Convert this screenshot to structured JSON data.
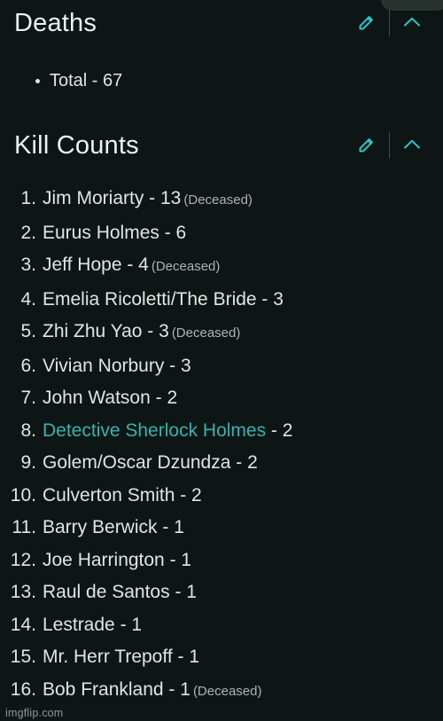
{
  "accent_color": "#28c8c8",
  "link_color": "#35b3b3",
  "background_color": "#0d1614",
  "text_color": "#dfe6e4",
  "sections": {
    "deaths": {
      "title": "Deaths",
      "edit_icon": "pencil-icon",
      "collapse_icon": "chevron-up-icon",
      "bullets": [
        {
          "text": "Total - 67"
        }
      ]
    },
    "kill_counts": {
      "title": "Kill Counts",
      "edit_icon": "pencil-icon",
      "collapse_icon": "chevron-up-icon",
      "items": [
        {
          "num": "1.",
          "name": "Jim Moriarty",
          "sep": " - ",
          "count": "13",
          "note": "(Deceased)",
          "is_link": false
        },
        {
          "num": "2.",
          "name": "Eurus Holmes",
          "sep": " - ",
          "count": "6",
          "note": "",
          "is_link": false
        },
        {
          "num": "3.",
          "name": "Jeff Hope",
          "sep": " - ",
          "count": "4",
          "note": "(Deceased)",
          "is_link": false
        },
        {
          "num": "4.",
          "name": "Emelia Ricoletti/The Bride",
          "sep": " - ",
          "count": "3",
          "note": "",
          "is_link": false
        },
        {
          "num": "5.",
          "name": "Zhi Zhu Yao",
          "sep": " - ",
          "count": "3",
          "note": "(Deceased)",
          "is_link": false
        },
        {
          "num": "6.",
          "name": "Vivian Norbury",
          "sep": " - ",
          "count": "3",
          "note": "",
          "is_link": false
        },
        {
          "num": "7.",
          "name": "John Watson",
          "sep": " - ",
          "count": "2",
          "note": "",
          "is_link": false
        },
        {
          "num": "8.",
          "name": "Detective Sherlock Holmes",
          "sep": " - ",
          "count": "2",
          "note": "",
          "is_link": true
        },
        {
          "num": "9.",
          "name": "Golem/Oscar Dzundza",
          "sep": " - ",
          "count": "2",
          "note": "",
          "is_link": false
        },
        {
          "num": "10.",
          "name": "Culverton Smith",
          "sep": " - ",
          "count": "2",
          "note": "",
          "is_link": false
        },
        {
          "num": "11.",
          "name": "Barry Berwick",
          "sep": " - ",
          "count": "1",
          "note": "",
          "is_link": false
        },
        {
          "num": "12.",
          "name": "Joe Harrington",
          "sep": " - ",
          "count": "1",
          "note": "",
          "is_link": false
        },
        {
          "num": "13.",
          "name": "Raul de Santos",
          "sep": " - ",
          "count": "1",
          "note": "",
          "is_link": false
        },
        {
          "num": "14.",
          "name": "Lestrade",
          "sep": " - ",
          "count": "1",
          "note": "",
          "is_link": false
        },
        {
          "num": "15.",
          "name": "Mr. Herr Trepoff",
          "sep": " - ",
          "count": "1",
          "note": "",
          "is_link": false
        },
        {
          "num": "16.",
          "name": "Bob Frankland",
          "sep": " - ",
          "count": "1",
          "note": "(Deceased)",
          "is_link": false
        }
      ]
    }
  },
  "watermark": "imgflip.com"
}
